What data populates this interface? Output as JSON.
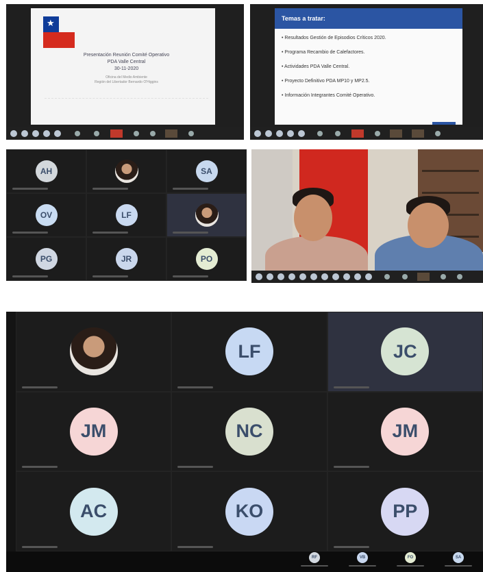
{
  "slide1": {
    "title_line1": "Presentación Reunión Comité Operativo",
    "title_line2": "PDA Valle Central",
    "title_line3": "30-11-2020",
    "subtitle_line1": "Oficina del Medio Ambiente",
    "subtitle_line2": "Región del Libertador Bernardo O'Higgins"
  },
  "slide2": {
    "heading": "Temas a tratar:",
    "items": [
      "• Resultados Gestión de Episodios Críticos 2020.",
      "• Programa Recambio de Calefactores.",
      "• Actividades PDA Valle Central.",
      "• Proyecto Definitivo PDA MP10 y MP2.5.",
      "• Información Integrantes Comité Operativo."
    ]
  },
  "grid_small": {
    "tiles": [
      {
        "initials": "AH",
        "color": "#d3d8dc"
      },
      {
        "initials": "",
        "color": "#ffffff",
        "photo": true
      },
      {
        "initials": "SA",
        "color": "#c7d8ee"
      },
      {
        "initials": "OV",
        "color": "#c9dcf2"
      },
      {
        "initials": "LF",
        "color": "#c9d9f0"
      },
      {
        "initials": "",
        "color": "#ffffff",
        "photo": true,
        "highlight": true
      },
      {
        "initials": "PG",
        "color": "#d0d7e2"
      },
      {
        "initials": "JR",
        "color": "#cad7ec"
      },
      {
        "initials": "PO",
        "color": "#e4ecd3"
      }
    ]
  },
  "grid_large": {
    "tiles": [
      {
        "initials": "",
        "color": "#ffffff",
        "photo": true
      },
      {
        "initials": "LF",
        "color": "#c7d9f3"
      },
      {
        "initials": "JC",
        "color": "#d6e4d3",
        "highlight": true
      },
      {
        "initials": "JM",
        "color": "#f6d6d6"
      },
      {
        "initials": "NC",
        "color": "#d9e0cf"
      },
      {
        "initials": "JM",
        "color": "#f6d6d6"
      },
      {
        "initials": "AC",
        "color": "#d3e9ef"
      },
      {
        "initials": "KO",
        "color": "#c9d8f3"
      },
      {
        "initials": "PP",
        "color": "#d7d8f3"
      }
    ],
    "mini": [
      {
        "initials": "RF",
        "color": "#d3d9e0"
      },
      {
        "initials": "VB",
        "color": "#c9d8f0"
      },
      {
        "initials": "FO",
        "color": "#e4ecd3"
      },
      {
        "initials": "SA",
        "color": "#c7d8ee"
      }
    ]
  },
  "colors": {
    "accent": "#2b55a3",
    "bg": "#1c1c1c",
    "chile_red": "#d52b1e",
    "chile_blue": "#0f3c99"
  }
}
